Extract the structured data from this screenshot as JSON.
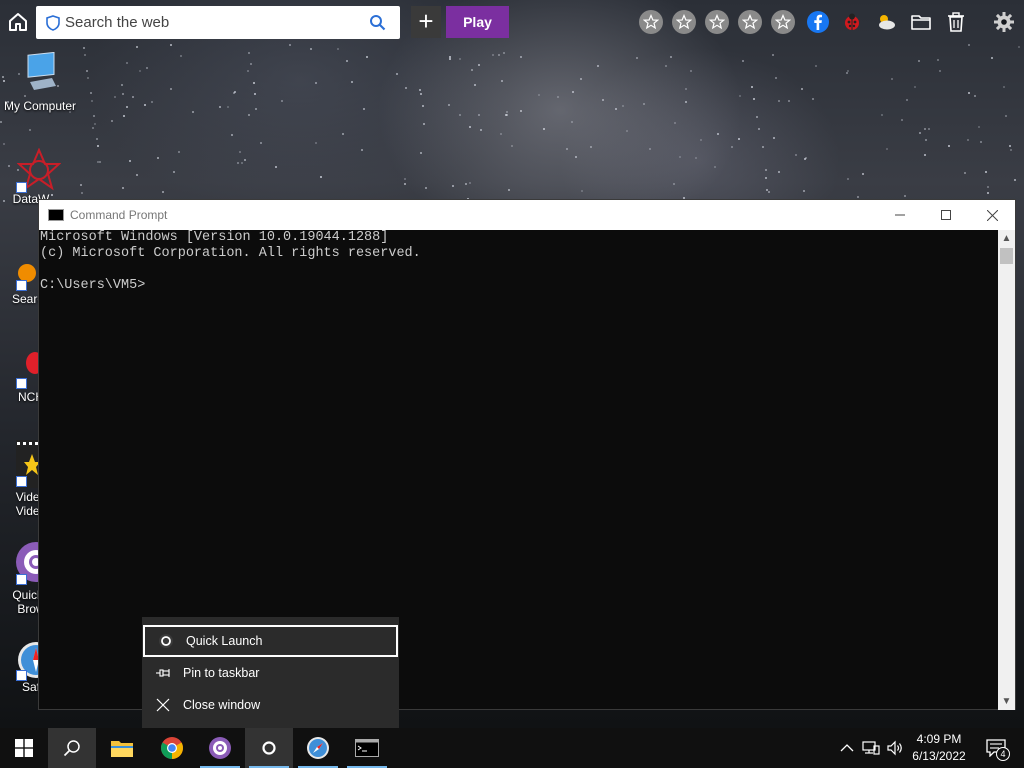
{
  "colors": {
    "play_button": "#7b2fa0",
    "console_bg": "#0c0c0c",
    "console_text": "#cccccc",
    "taskbar": "#101010",
    "jumplist_bg": "#2b2b2b",
    "accent_underline": "#76b9ed"
  },
  "toolbar": {
    "search_placeholder": "Search the web",
    "play_label": "Play",
    "plus_label": "+",
    "icons": [
      "home-icon",
      "shield-icon",
      "search-icon",
      "star-icon",
      "star-icon",
      "star-icon",
      "star-icon",
      "star-icon",
      "facebook-icon",
      "ladybug-icon",
      "weather-icon",
      "folder-icon",
      "trash-icon",
      "gear-icon"
    ]
  },
  "desktop": {
    "icons": [
      {
        "label": "My Computer",
        "icon": "computer-icon"
      },
      {
        "label": "DataW",
        "icon": "datawatch-icon"
      },
      {
        "label": "Search",
        "icon": "search-app-icon"
      },
      {
        "label": "NCH",
        "icon": "nch-icon"
      },
      {
        "label": "Video",
        "label2": "Video",
        "icon": "video-icon"
      },
      {
        "label": "QuickL",
        "label2": "Brow",
        "icon": "quicklaunch-browser-icon"
      },
      {
        "label": "Saf",
        "icon": "safari-icon"
      }
    ]
  },
  "cmd": {
    "title": "Command Prompt",
    "line1": "Microsoft Windows [Version 10.0.19044.1288]",
    "line2": "(c) Microsoft Corporation. All rights reserved.",
    "line3": "",
    "line4": "C:\\Users\\VM5>"
  },
  "jumplist": {
    "items": [
      {
        "label": "Quick Launch",
        "icon": "quicklaunch-icon"
      },
      {
        "label": "Pin to taskbar",
        "icon": "pin-icon"
      },
      {
        "label": "Close window",
        "icon": "close-icon"
      }
    ]
  },
  "taskbar": {
    "apps": [
      "windows-start-icon",
      "search-icon",
      "file-explorer-icon",
      "chrome-icon",
      "quicklaunch-browser-icon",
      "quicklaunch-icon",
      "safari-icon",
      "command-prompt-icon"
    ],
    "time": "4:09 PM",
    "date": "6/13/2022",
    "notification_count": "4"
  }
}
